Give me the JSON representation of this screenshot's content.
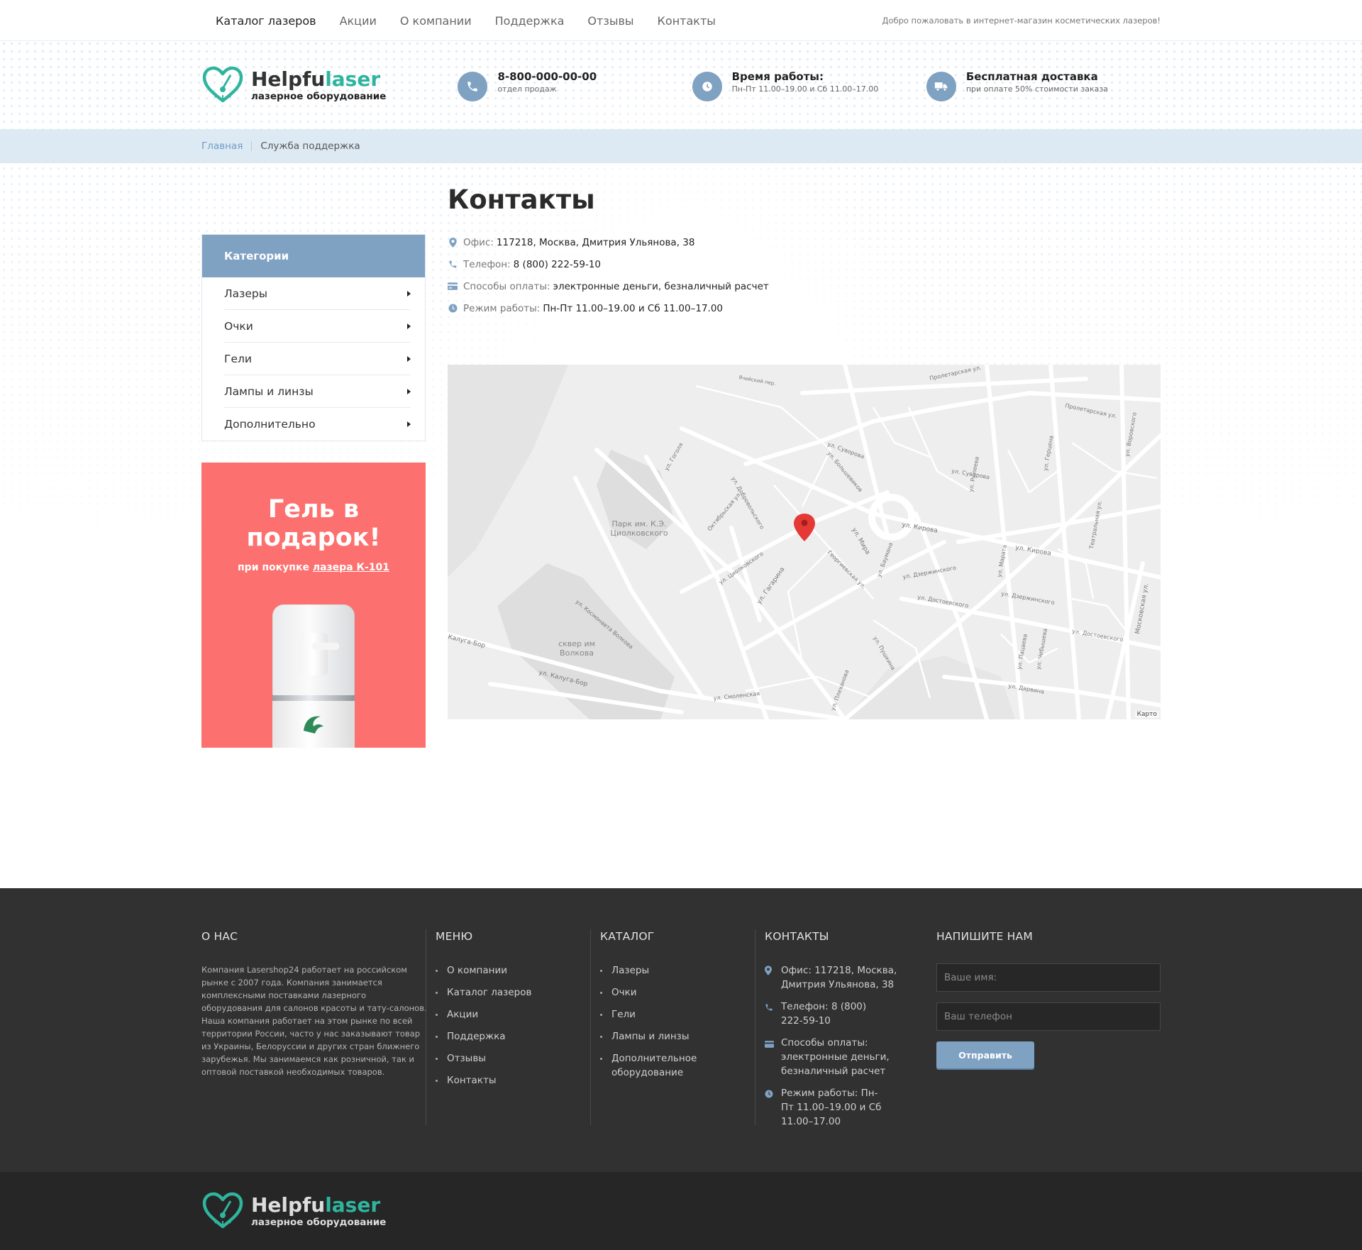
{
  "topnav": {
    "items": [
      "Каталог лазеров",
      "Акции",
      "О компании",
      "Поддержка",
      "Отзывы",
      "Контакты"
    ],
    "welcome": "Добро пожаловать в интернет-магазин косметических лазеров!"
  },
  "logo": {
    "brand_a": "Helpfu",
    "brand_b": "laser",
    "tagline": "лазерное оборудование"
  },
  "header_info": {
    "phone": {
      "title": "8-800-000-00-00",
      "sub": "отдел продаж"
    },
    "hours": {
      "title": "Время работы:",
      "sub": "Пн-Пт 11.00–19.00 и Сб 11.00–17.00"
    },
    "delivery": {
      "title": "Бесплатная доставка",
      "sub": "при оплате 50% стоимости заказа"
    }
  },
  "breadcrumb": {
    "home": "Главная",
    "current": "Служба поддержка"
  },
  "sidebar": {
    "title": "Категории",
    "items": [
      "Лазеры",
      "Очки",
      "Гели",
      "Лампы и линзы",
      "Дополнительно"
    ]
  },
  "promo": {
    "line1": "Гель в",
    "line2": "подарок!",
    "sub_prefix": "при покупке ",
    "sub_link": "лазера К-101"
  },
  "page": {
    "title": "Контакты",
    "contacts": [
      {
        "icon": "location-pin-icon",
        "label": "Офис:",
        "value": "117218, Москва, Дмитрия Ульянова, 38"
      },
      {
        "icon": "phone-icon",
        "label": "Телефон:",
        "value": "8 (800) 222-59-10"
      },
      {
        "icon": "credit-card-icon",
        "label": "Способы оплаты:",
        "value": "электронные деньги, безналичный расчет"
      },
      {
        "icon": "clock-icon",
        "label": "Режим работы:",
        "value": "Пн-Пт 11.00–19.00 и Сб 11.00–17.00"
      }
    ]
  },
  "map": {
    "labels": [
      "Парк им. К.Э.",
      "Циолковского",
      "сквер им",
      "Волкова",
      "ул. Кирова",
      "ул. Кирова",
      "ул. Мира",
      "ул. Гагарина",
      "ул. Суворова",
      "ул. Суворова",
      "Пролетарская ул.",
      "Пролетарская ул.",
      "ул. Дзержинского",
      "ул. Дзержинского",
      "ул. Достоевского",
      "ул. Достоевского",
      "ул. Калуга-Бор",
      "Калуга-Бор",
      "ул. Смоленская",
      "ул. Циолковского",
      "Октябрьская ул.",
      "ул. Добровольского",
      "ул. Гоголя",
      "Московская ул.",
      "Георгиевская ул.",
      "ул. Баумана",
      "ул. Пушкина",
      "ул. Плеханова",
      "ул. Рылеева",
      "ул. Пацаева",
      "ул. Чебышева",
      "ул. Марата",
      "Театральная ул.",
      "ул. Герцена",
      "ул. Воровского",
      "Ячейский пер.",
      "ул. Космонавта Волкова",
      "ул. Дарвина",
      "ул. Большевиков"
    ],
    "attribution": "Карто"
  },
  "footer": {
    "about": {
      "title": "О НАС",
      "text": "Компания Lasershop24 работает на российском рынке с 2007 года. Компания занимается комплексными поставками лазерного оборудования для салонов красоты и тату-салонов. Наша компания работает на этом рынке по всей территории России, часто у нас заказывают товар из Украины, Белоруссии и других стран ближнего зарубежья. Мы занимаемся как розничной, так и оптовой поставкой необходимых товаров."
    },
    "menu": {
      "title": "МЕНЮ",
      "items": [
        "О компании",
        "Каталог лазеров",
        "Акции",
        "Поддержка",
        "Отзывы",
        "Контакты"
      ]
    },
    "catalog": {
      "title": "КАТАЛОГ",
      "items": [
        "Лазеры",
        "Очки",
        "Гели",
        "Лампы и линзы",
        "Дополнительное оборудование"
      ]
    },
    "contacts": {
      "title": "КОНТАКТЫ",
      "items": [
        "Офис: 117218, Москва, Дмитрия Ульянова, 38",
        "Телефон: 8 (800) 222-59-10",
        "Способы оплаты: электронные деньги, безналичный расчет",
        "Режим работы: Пн-Пт 11.00–19.00 и Сб 11.00–17.00"
      ]
    },
    "form": {
      "title": "НАПИШИТЕ НАМ",
      "name_placeholder": "Ваше имя:",
      "phone_placeholder": "Ваш телефон",
      "submit": "Отправить"
    }
  },
  "colors": {
    "accent": "#7fa1c2",
    "brand_green": "#2fb59e",
    "promo": "#fc716f",
    "footer": "#313131",
    "map_pin": "#e53935"
  }
}
